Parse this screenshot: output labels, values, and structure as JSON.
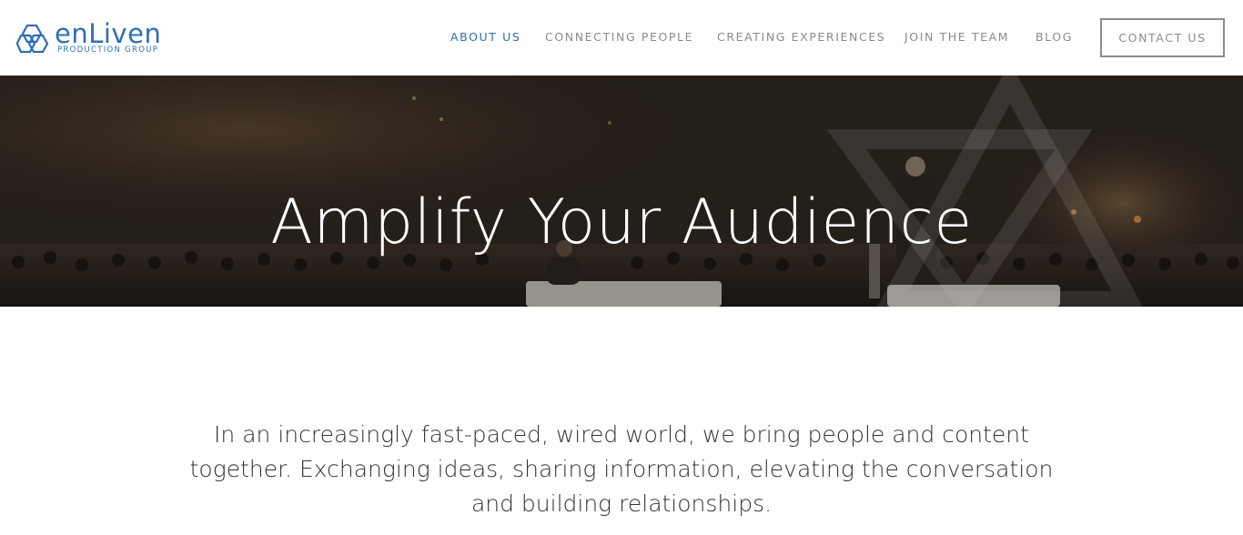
{
  "brand": {
    "name": "enLiven",
    "tagline": "PRODUCTION GROUP",
    "logo_icon": "hexagon-logo-icon",
    "color": "#2e6fb5"
  },
  "nav": {
    "items": [
      {
        "label": "ABOUT US",
        "active": true
      },
      {
        "label": "CONNECTING PEOPLE",
        "active": false
      },
      {
        "label": "CREATING EXPERIENCES",
        "active": false
      },
      {
        "label": "JOIN THE TEAM",
        "active": false
      },
      {
        "label": "BLOG",
        "active": false
      }
    ],
    "contact_label": "CONTACT US",
    "active_color": "#2e6fb5",
    "inactive_color": "#8a8a8a"
  },
  "hero": {
    "title": "Amplify Your Audience"
  },
  "intro": {
    "text": "In an increasingly fast-paced, wired world, we bring people and content together. Exchanging ideas, sharing information, elevating the conversation and building relationships."
  }
}
